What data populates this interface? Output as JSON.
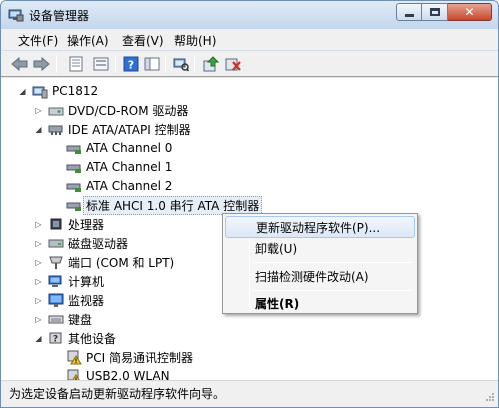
{
  "window": {
    "title": "设备管理器"
  },
  "menubar": {
    "items": [
      "文件(F)",
      "操作(A)",
      "查看(V)",
      "帮助(H)"
    ]
  },
  "toolbar": {
    "icons": [
      "back-arrow-icon",
      "forward-arrow-icon",
      "properties-icon",
      "list-icon",
      "help-icon",
      "pane-icon",
      "scan-hardware-icon",
      "update-driver-icon",
      "uninstall-icon"
    ]
  },
  "tree": {
    "root": "PC1812",
    "nodes": [
      {
        "label": "DVD/CD-ROM 驱动器",
        "icon": "dvd-drive-icon"
      },
      {
        "label": "IDE ATA/ATAPI 控制器",
        "icon": "ide-controller-icon"
      },
      {
        "label": "ATA Channel 0",
        "icon": "ide-channel-icon"
      },
      {
        "label": "ATA Channel 1",
        "icon": "ide-channel-icon"
      },
      {
        "label": "ATA Channel 2",
        "icon": "ide-channel-icon"
      },
      {
        "label": "标准 AHCI 1.0 串行 ATA 控制器",
        "icon": "ide-channel-icon"
      },
      {
        "label": "处理器",
        "icon": "processor-icon"
      },
      {
        "label": "磁盘驱动器",
        "icon": "disk-drive-icon"
      },
      {
        "label": "端口 (COM 和 LPT)",
        "icon": "port-icon"
      },
      {
        "label": "计算机",
        "icon": "computer-icon"
      },
      {
        "label": "监视器",
        "icon": "monitor-icon"
      },
      {
        "label": "键盘",
        "icon": "keyboard-icon"
      },
      {
        "label": "其他设备",
        "icon": "other-devices-icon"
      },
      {
        "label": "PCI 简易通讯控制器",
        "icon": "warning-device-icon"
      },
      {
        "label": "USB2.0 WLAN",
        "icon": "warning-device-icon"
      }
    ]
  },
  "context_menu": {
    "items": [
      "更新驱动程序软件(P)...",
      "卸载(U)",
      "扫描检测硬件改动(A)",
      "属性(R)"
    ]
  },
  "status": {
    "text": "为选定设备启动更新驱动程序软件向导。"
  }
}
